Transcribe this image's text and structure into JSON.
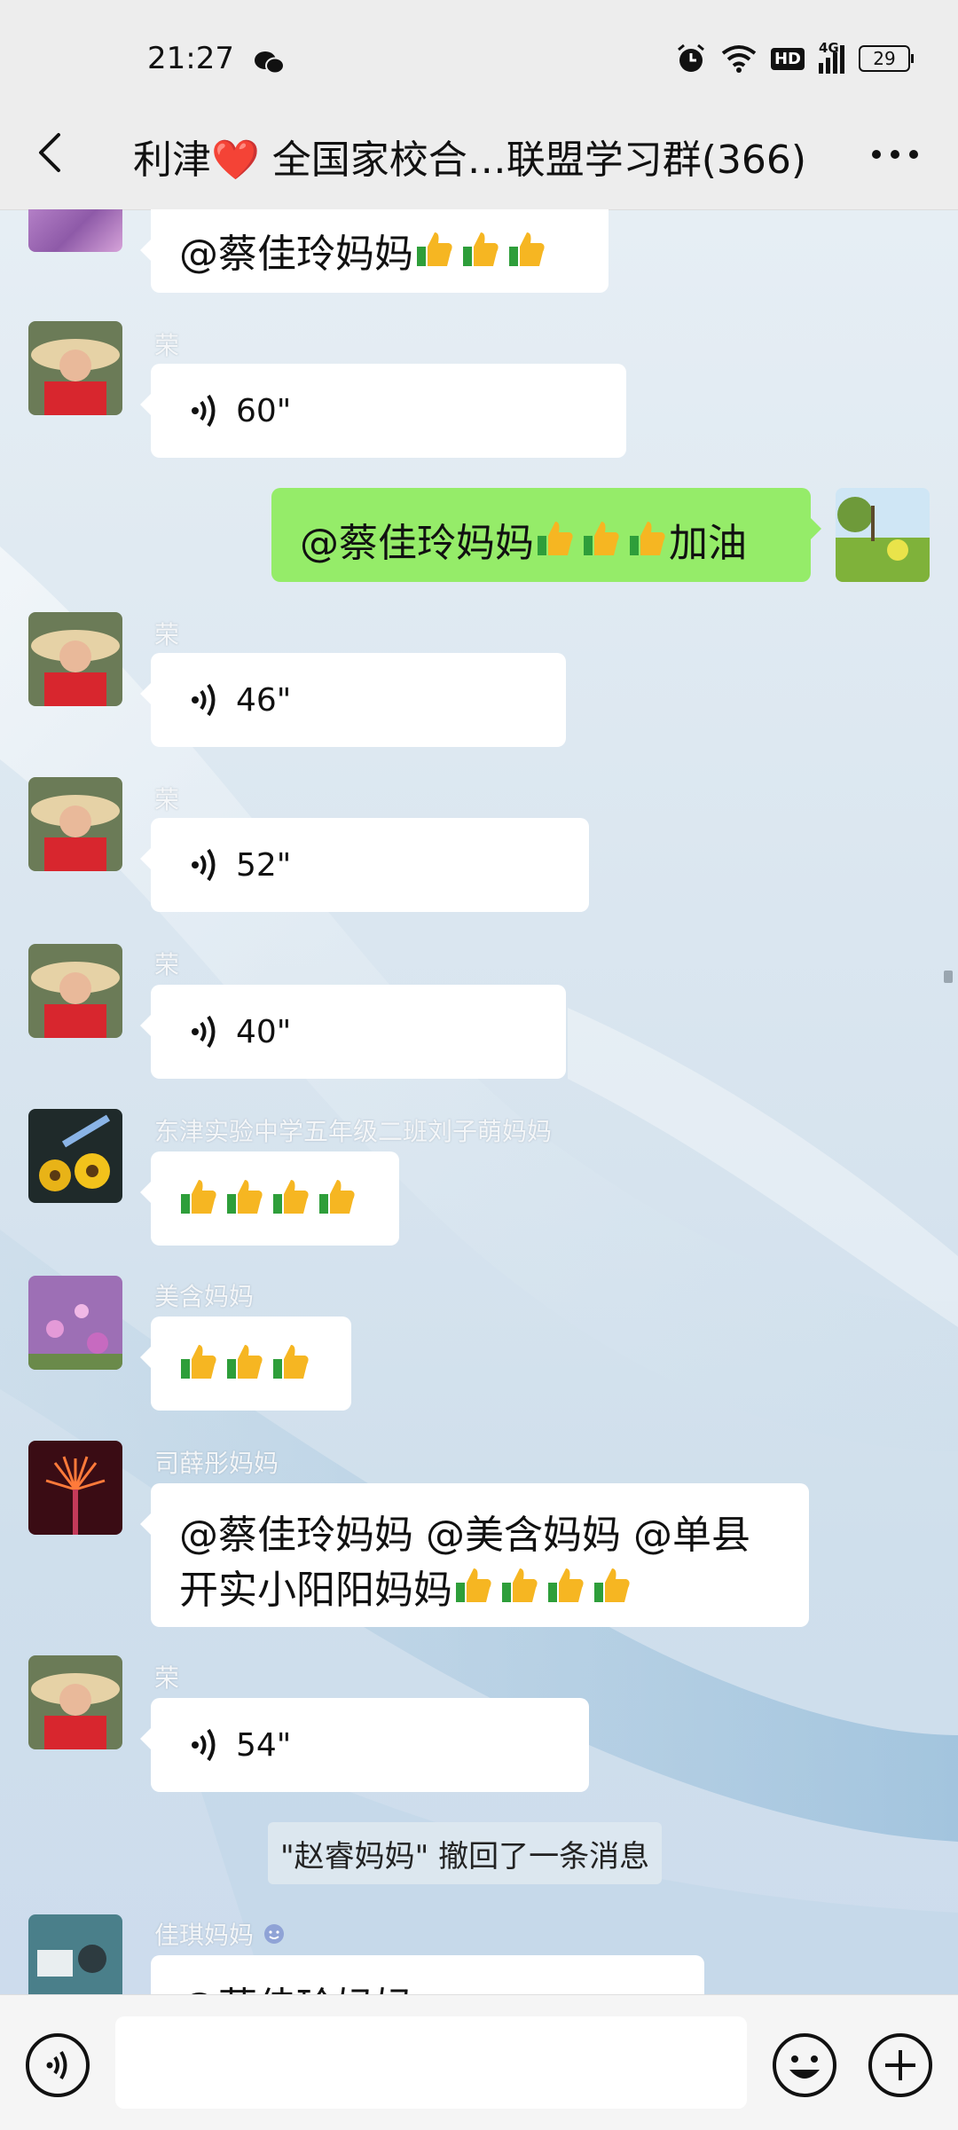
{
  "status_bar": {
    "time": "21:27",
    "battery": "29",
    "network": "4G",
    "hd": "HD"
  },
  "header": {
    "title": "利津❤️ 全国家校合…联盟学习群(366)"
  },
  "messages": [
    {
      "type": "text",
      "sender": "",
      "self": false,
      "text": "@蔡佳玲妈妈 ",
      "thumbs": 3
    },
    {
      "type": "voice",
      "sender": "荣",
      "self": false,
      "duration": "60\""
    },
    {
      "type": "text",
      "sender": "",
      "self": true,
      "text_before": "@蔡佳玲妈妈 ",
      "thumbs": 3,
      "text_after": "加油"
    },
    {
      "type": "voice",
      "sender": "荣",
      "self": false,
      "duration": "46\""
    },
    {
      "type": "voice",
      "sender": "荣",
      "self": false,
      "duration": "52\""
    },
    {
      "type": "voice",
      "sender": "荣",
      "self": false,
      "duration": "40\""
    },
    {
      "type": "emoji",
      "sender": "东津实验中学五年级二班刘子萌妈妈",
      "self": false,
      "thumbs": 4
    },
    {
      "type": "emoji",
      "sender": "美含妈妈",
      "self": false,
      "thumbs": 3
    },
    {
      "type": "text",
      "sender": "司薛彤妈妈",
      "self": false,
      "line1": "@蔡佳玲妈妈 @美含妈妈 @单县",
      "line2": "开实小阳阳妈妈 ",
      "thumbs": 4
    },
    {
      "type": "voice",
      "sender": "荣",
      "self": false,
      "duration": "54\""
    },
    {
      "type": "text",
      "sender": "佳琪妈妈",
      "self": false,
      "text": "@蔡佳玲妈妈 "
    }
  ],
  "system": {
    "recall_notice": "\"赵睿妈妈\" 撤回了一条消息"
  },
  "icons": {
    "back": "chevron-left-icon",
    "more": "more-dots-icon",
    "voice": "voice-wave-icon",
    "emoji": "smiley-icon",
    "plus": "plus-circle-icon",
    "thumb": "thumbs-up-icon"
  },
  "colors": {
    "self_bubble": "#95ec69",
    "other_bubble": "#ffffff",
    "topbar": "#ededed"
  }
}
